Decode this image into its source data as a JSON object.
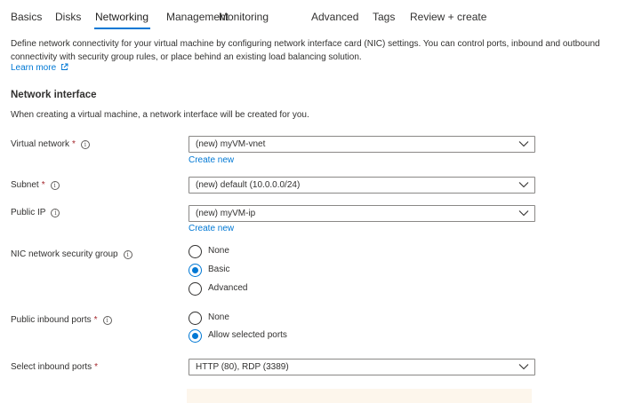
{
  "tabs": [
    "Basics",
    "Disks",
    "Networking",
    "Management",
    "Monitoring",
    "Advanced",
    "Tags",
    "Review + create"
  ],
  "active_tab": "Networking",
  "description": "Define network connectivity for your virtual machine by configuring network interface card (NIC) settings. You can control ports, inbound and outbound connectivity with security group rules, or place behind an existing load balancing solution.",
  "learn_more": "Learn more",
  "section": {
    "title": "Network interface",
    "subtitle": "When creating a virtual machine, a network interface will be created for you."
  },
  "fields": {
    "virtual_network": {
      "label": "Virtual network",
      "required": "*",
      "value": "(new) myVM-vnet",
      "link": "Create new"
    },
    "subnet": {
      "label": "Subnet",
      "required": "*",
      "value": "(new) default (10.0.0.0/24)"
    },
    "public_ip": {
      "label": "Public IP",
      "value": "(new) myVM-ip",
      "link": "Create new"
    },
    "nic_nsg": {
      "label": "NIC network security group",
      "options": [
        "None",
        "Basic",
        "Advanced"
      ],
      "selected": "Basic"
    },
    "public_inbound_ports": {
      "label": "Public inbound ports",
      "required": "*",
      "options": [
        "None",
        "Allow selected ports"
      ],
      "selected": "Allow selected ports"
    },
    "select_inbound_ports": {
      "label": "Select inbound ports",
      "required": "*",
      "value": "HTTP (80), RDP (3389)"
    }
  },
  "colors": {
    "accent": "#0078d4",
    "required": "#a4262c",
    "warning_bg": "#fdf6ec"
  },
  "icons": {
    "info": "info-icon",
    "chevron": "chevron-down-icon",
    "external": "external-link-icon"
  }
}
